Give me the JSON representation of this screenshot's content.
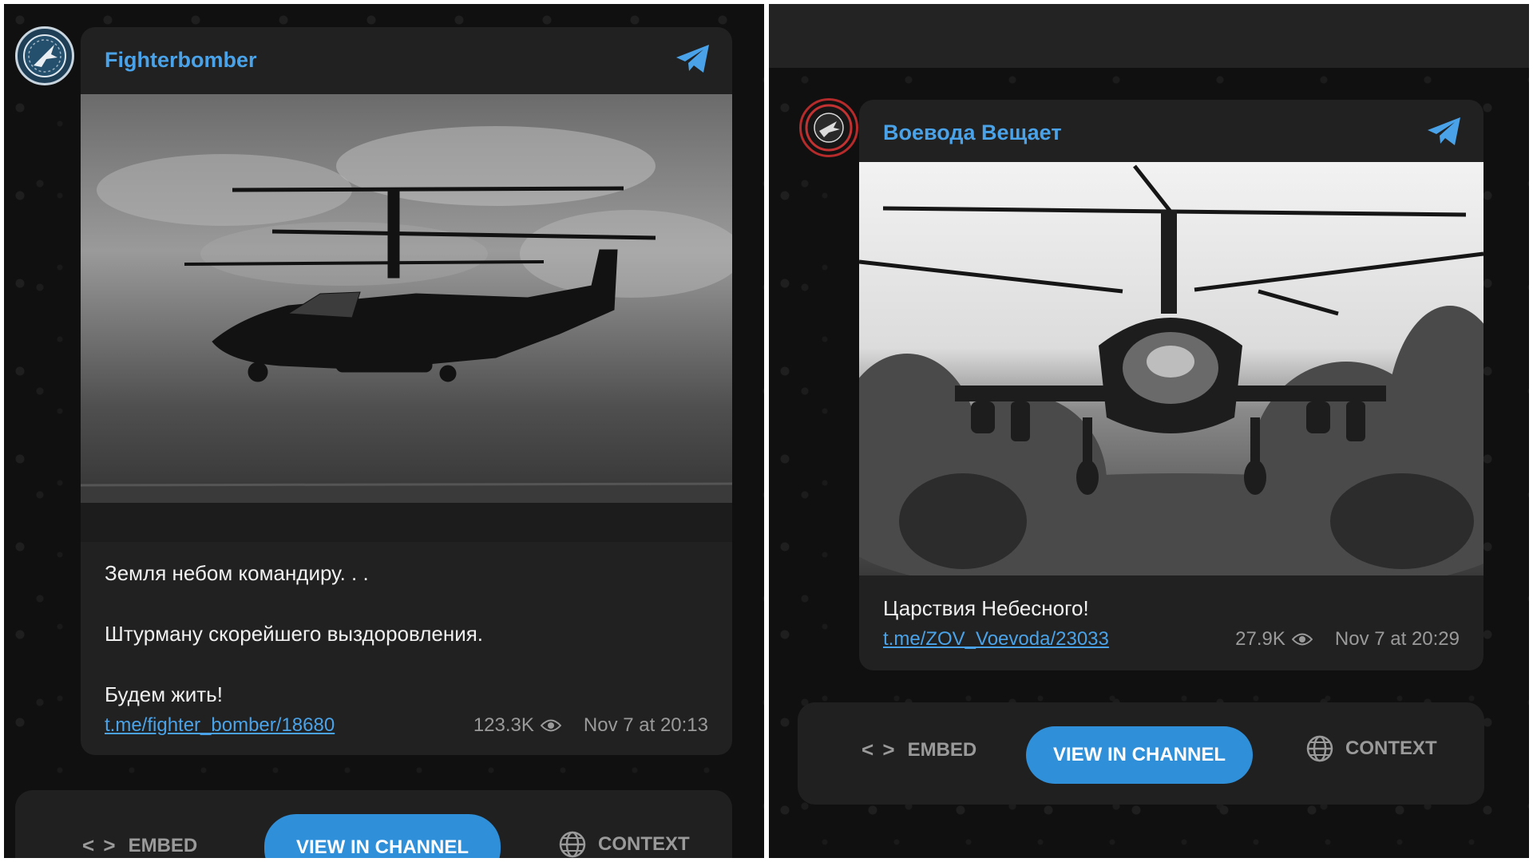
{
  "colors": {
    "accent": "#4aa3e8",
    "button": "#2f8fd8",
    "card": "#212121",
    "background": "#101010",
    "meta_text": "#9a9a9a"
  },
  "posts": [
    {
      "channel": "Fighterbomber",
      "avatar_icon": "fighterbomber-logo-icon",
      "photo": "helicopter-in-flight-photo",
      "lines": [
        "Земля небом командиру. . .",
        "Штурману скорейшего выздоровления.",
        "Будем жить!"
      ],
      "link": "t.me/fighter_bomber/18680",
      "views": "123.3K",
      "time": "Nov 7 at 20:13"
    },
    {
      "channel": "Воевода Вещает",
      "avatar_icon": "voevoda-logo-icon",
      "photo": "helicopter-front-view-photo",
      "lines": [
        "Царствия Небесного!"
      ],
      "link": "t.me/ZOV_Voevoda/23033",
      "views": "27.9K",
      "time": "Nov 7 at 20:29"
    }
  ],
  "actions": {
    "embed": "EMBED",
    "view": "VIEW IN CHANNEL",
    "context": "CONTEXT"
  }
}
